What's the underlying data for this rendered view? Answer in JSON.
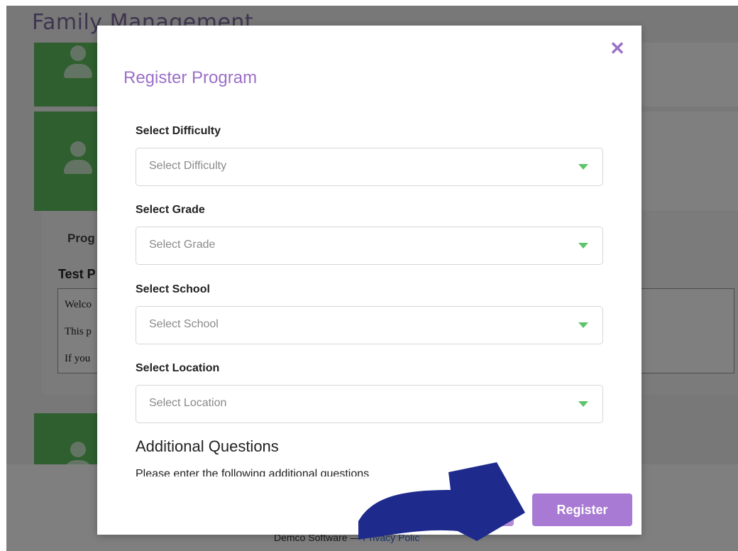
{
  "background": {
    "title": "Family Management",
    "program_tab": "Prog",
    "test_heading": "Test P",
    "textarea_lines": [
      "Welco",
      "This p",
      "If you"
    ],
    "footer_company": "Demco Software",
    "footer_sep": "—",
    "footer_link": "Privacy Polic"
  },
  "modal": {
    "title": "Register Program",
    "close_symbol": "✕",
    "fields": [
      {
        "label": "Select Difficulty",
        "placeholder": "Select Difficulty"
      },
      {
        "label": "Select Grade",
        "placeholder": "Select Grade"
      },
      {
        "label": "Select School",
        "placeholder": "Select School"
      },
      {
        "label": "Select Location",
        "placeholder": "Select Location"
      }
    ],
    "section_title": "Additional Questions",
    "section_desc": "Please enter the following additional questions",
    "cancel_label": "",
    "register_label": "Register"
  },
  "colors": {
    "accent": "#9b6fc8",
    "button": "#a87ad3",
    "caret": "#5ec46a",
    "arrow": "#1e2a8c"
  },
  "icons": {
    "close": "close-icon",
    "caret": "chevron-down-icon",
    "avatar": "user-avatar-icon",
    "annotation": "arrow-annotation-icon"
  }
}
